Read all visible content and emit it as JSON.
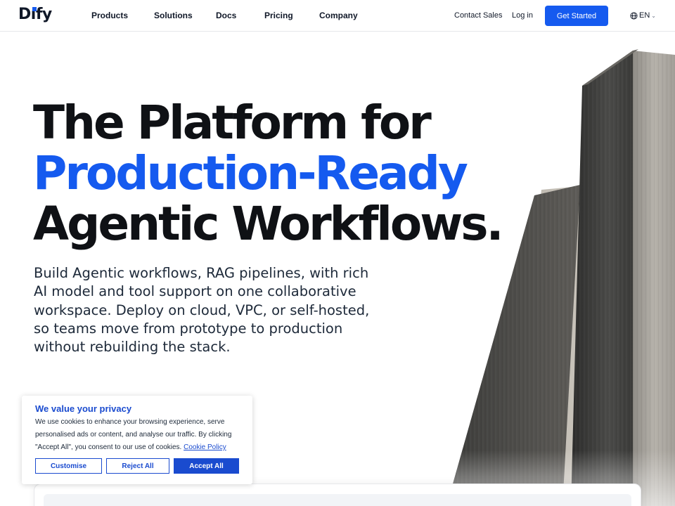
{
  "brand": {
    "logo_text_pre": "D",
    "logo_text_i": "ı",
    "logo_text_post": "fy"
  },
  "nav": {
    "items": [
      {
        "label": "Products"
      },
      {
        "label": "Solutions"
      },
      {
        "label": "Docs"
      },
      {
        "label": "Pricing"
      },
      {
        "label": "Company"
      }
    ],
    "contact_sales": "Contact Sales",
    "login": "Log in",
    "get_started": "Get Started",
    "language": "EN",
    "language_icon": "globe-icon",
    "language_chevron_icon": "chevron-down-icon"
  },
  "hero": {
    "title_line1": "The Platform for",
    "title_line2": "Production-Ready",
    "title_line3": "Agentic Workflows.",
    "description": "Build Agentic workflows, RAG pipelines, with rich AI model and tool support on one collaborative workspace. Deploy on cloud, VPC, or self-hosted, so teams move from prototype to production without rebuilding the stack."
  },
  "cookie_banner": {
    "title": "We value your privacy",
    "text": "We use cookies to enhance your browsing experience, serve personalised ads or content, and analyse our traffic. By clicking \"Accept All\", you consent to our use of cookies. ",
    "policy_link": "Cookie Policy",
    "customise": "Customise",
    "reject_all": "Reject All",
    "accept_all": "Accept All"
  },
  "colors": {
    "accent": "#155aef",
    "cookie_accent": "#1a4bcf",
    "text": "#0f1115"
  }
}
